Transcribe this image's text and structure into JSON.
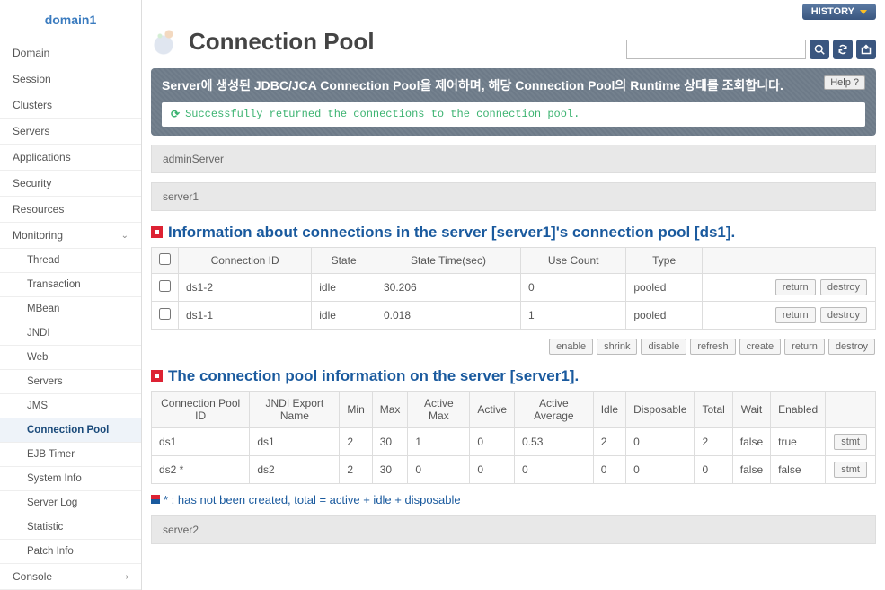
{
  "sidebar": {
    "header": "domain1",
    "items": [
      {
        "label": "Domain"
      },
      {
        "label": "Session"
      },
      {
        "label": "Clusters"
      },
      {
        "label": "Servers"
      },
      {
        "label": "Applications"
      },
      {
        "label": "Security"
      },
      {
        "label": "Resources"
      },
      {
        "label": "Monitoring",
        "expanded": true
      }
    ],
    "subitems": [
      {
        "label": "Thread"
      },
      {
        "label": "Transaction"
      },
      {
        "label": "MBean"
      },
      {
        "label": "JNDI"
      },
      {
        "label": "Web"
      },
      {
        "label": "Servers"
      },
      {
        "label": "JMS"
      },
      {
        "label": "Connection Pool",
        "active": true
      },
      {
        "label": "EJB Timer"
      },
      {
        "label": "System Info"
      },
      {
        "label": "Server Log"
      },
      {
        "label": "Statistic"
      },
      {
        "label": "Patch Info"
      }
    ],
    "console": "Console"
  },
  "topbar": {
    "history": "HISTORY"
  },
  "page": {
    "title": "Connection Pool"
  },
  "search": {
    "placeholder": ""
  },
  "banner": {
    "text": "Server에 생성된 JDBC/JCA Connection Pool을 제어하며, 해당 Connection Pool의 Runtime 상태를 조회합니다.",
    "help": "Help ?",
    "success": "Successfully returned the connections to the connection pool."
  },
  "servers": {
    "admin": "adminServer",
    "s1": "server1",
    "s2": "server2"
  },
  "conn_section": {
    "title": "Information about connections in the server [server1]'s connection pool [ds1].",
    "headers": [
      "Connection ID",
      "State",
      "State Time(sec)",
      "Use Count",
      "Type"
    ],
    "rows": [
      {
        "id": "ds1-2",
        "state": "idle",
        "time": "30.206",
        "use": "0",
        "type": "pooled"
      },
      {
        "id": "ds1-1",
        "state": "idle",
        "time": "0.018",
        "use": "1",
        "type": "pooled"
      }
    ],
    "row_actions": {
      "return": "return",
      "destroy": "destroy"
    }
  },
  "action_bar": {
    "enable": "enable",
    "shrink": "shrink",
    "disable": "disable",
    "refresh": "refresh",
    "create": "create",
    "return": "return",
    "destroy": "destroy"
  },
  "pool_section": {
    "title": "The connection pool information on the server [server1].",
    "headers": [
      "Connection Pool ID",
      "JNDI Export Name",
      "Min",
      "Max",
      "Active Max",
      "Active",
      "Active Average",
      "Idle",
      "Disposable",
      "Total",
      "Wait",
      "Enabled",
      ""
    ],
    "rows": [
      {
        "id": "ds1",
        "jndi": "ds1",
        "min": "2",
        "max": "30",
        "amax": "1",
        "active": "0",
        "avg": "0.53",
        "idle": "2",
        "disp": "0",
        "total": "2",
        "wait": "false",
        "enabled": "true"
      },
      {
        "id": "ds2 *",
        "jndi": "ds2",
        "min": "2",
        "max": "30",
        "amax": "0",
        "active": "0",
        "avg": "0",
        "idle": "0",
        "disp": "0",
        "total": "0",
        "wait": "false",
        "enabled": "false"
      }
    ],
    "stmt": "stmt"
  },
  "note": "* : has not been created, total = active + idle + disposable"
}
